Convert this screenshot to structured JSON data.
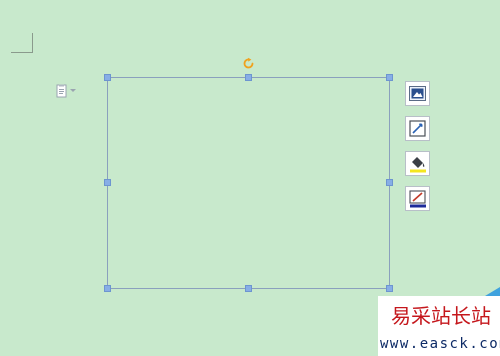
{
  "colors": {
    "background": "#c8e9cc",
    "frame": "#8aa0bd",
    "handle": "#87aee6",
    "rotate": "#f0a21e",
    "watermark_red": "#c5171c",
    "watermark_blue": "#3fa2de",
    "watermark_url": "#0d2a66"
  },
  "icons": {
    "paste": "paste-options-icon",
    "rotate": "rotate-icon",
    "layout": "layout-options-icon",
    "style": "shape-style-icon",
    "fill": "fill-bucket-icon",
    "outline": "outline-pen-icon"
  },
  "watermark": {
    "title": "易采站长站",
    "url": "www.easck.com"
  }
}
